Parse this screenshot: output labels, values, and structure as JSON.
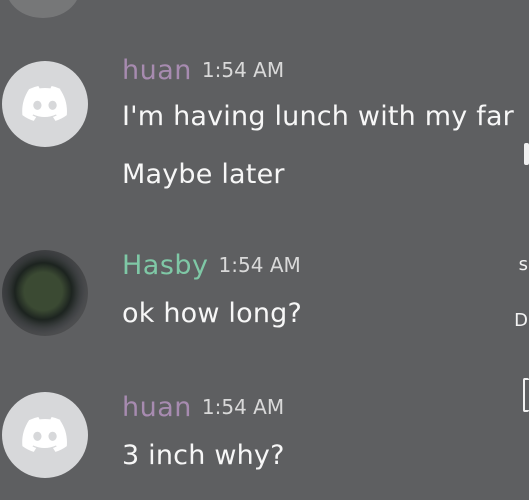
{
  "messages": [
    {
      "author": "huan",
      "time": "1:54 AM",
      "avatar": "discord-default-avatar",
      "lines": [
        "I'm having lunch with my far",
        "Maybe later"
      ]
    },
    {
      "author": "Hasby",
      "time": "1:54 AM",
      "avatar": "user-photo-avatar",
      "lines": [
        "ok how long?"
      ]
    },
    {
      "author": "huan",
      "time": "1:54 AM",
      "avatar": "discord-default-avatar",
      "lines": [
        "3 inch why?"
      ]
    }
  ],
  "edge_text": {
    "d": "D",
    "s": "s"
  },
  "colors": {
    "background": "#5e5f61",
    "huan_name": "#a78bb0",
    "hasby_name": "#7fc8a6",
    "message_text": "#f7f7f7"
  }
}
